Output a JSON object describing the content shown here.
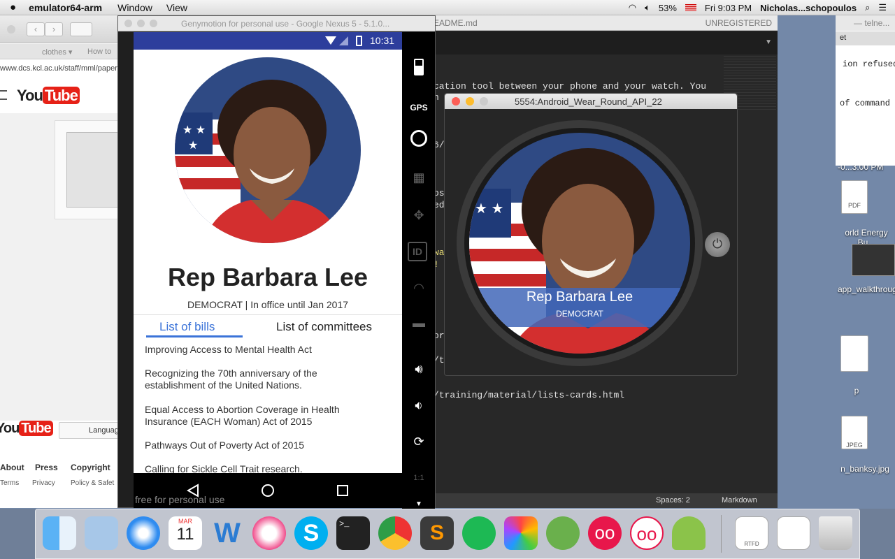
{
  "menubar": {
    "apple": "",
    "app_name": "emulator64-arm",
    "menus": [
      "Window",
      "View"
    ],
    "battery": "53%",
    "clock": "Fri 9:03 PM",
    "user": "Nicholas...schopoulos"
  },
  "safari": {
    "bookmarks": [
      "clothes ▾",
      "How to"
    ],
    "url": "www.dcs.kcl.ac.uk/staff/mml/paper",
    "youtube": "YouTube",
    "youtube_footer": "YouTube",
    "language": "Languag",
    "footer_links": [
      "About",
      "Press",
      "Copyright"
    ],
    "footer_links2": [
      "Terms",
      "Privacy",
      "Policy & Safet"
    ]
  },
  "editor": {
    "tab_title": "EADME.md",
    "unregistered": "UNREGISTERED",
    "line1": "cation tool between your phone and your watch. You",
    "line2": "n",
    "line3": "6/",
    "line4": "os",
    "line5": "ed",
    "line6": "wa",
    "line7": "! (",
    "line8": "or",
    "line9": "/t",
    "line10": "/training/material/lists-cards.html",
    "status_spaces": "Spaces: 2",
    "status_syntax": "Markdown"
  },
  "terminal": {
    "title": "— telne...",
    "line1": "ion refused",
    "line2": "of command",
    "tab": "et"
  },
  "desktop": {
    "time_label": "-0...3.00 PM",
    "pdf_label": "PDF",
    "file1": "orld Energy Bu...",
    "file2": "app_walkthrough",
    "file3": "p",
    "jpeg_label": "JPEG",
    "file4": "n_banksy.jpg"
  },
  "genymotion": {
    "title": "Genymotion for personal use - Google Nexus 5 - 5.1.0...",
    "footer": "free for personal use",
    "side_label": "1:1",
    "gps_label": "GPS"
  },
  "phone": {
    "time": "10:31",
    "name": "Rep Barbara Lee",
    "subtitle": "DEMOCRAT | In office until Jan 2017",
    "tabs": [
      "List of bills",
      "List of committees"
    ],
    "bills": [
      "Improving Access to Mental Health Act",
      "Recognizing the 70th anniversary of the establishment of the United Nations.",
      "Equal Access to Abortion Coverage in Health Insurance (EACH Woman) Act of 2015",
      "Pathways Out of Poverty Act of 2015",
      "Calling for Sickle Cell Trait research."
    ]
  },
  "wear": {
    "title": "5554:Android_Wear_Round_API_22",
    "name": "Rep Barbara Lee",
    "party": "DEMOCRAT"
  },
  "dock": {
    "calendar_month": "MAR",
    "calendar_day": "11",
    "rtfd": "RTFD"
  },
  "colors": {
    "accent": "#3f51b5",
    "tab_active": "#3b73d8",
    "status_bar": "#2d3e9c",
    "youtube_red": "#e62117"
  }
}
